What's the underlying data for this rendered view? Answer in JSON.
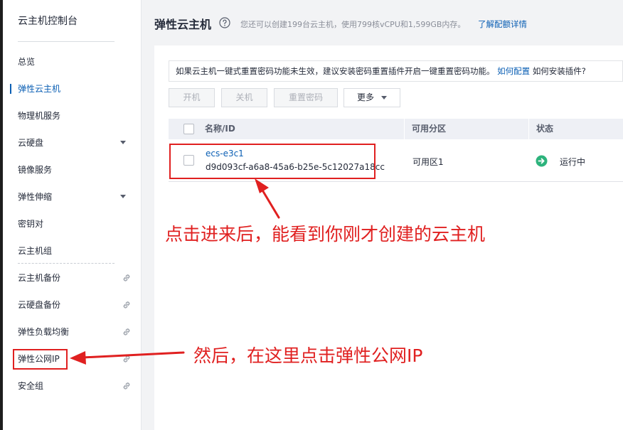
{
  "sidebar": {
    "title": "云主机控制台",
    "items": [
      {
        "label": "总览"
      },
      {
        "label": "弹性云主机"
      },
      {
        "label": "物理机服务"
      },
      {
        "label": "云硬盘"
      },
      {
        "label": "镜像服务"
      },
      {
        "label": "弹性伸缩"
      },
      {
        "label": "密钥对"
      },
      {
        "label": "云主机组"
      },
      {
        "label": "云主机备份"
      },
      {
        "label": "云硬盘备份"
      },
      {
        "label": "弹性负载均衡"
      },
      {
        "label": "弹性公网IP"
      },
      {
        "label": "安全组"
      }
    ]
  },
  "header": {
    "title": "弹性云主机",
    "description": "您还可以创建199台云主机，使用799核vCPU和1,599GB内存。",
    "link": "了解配额详情"
  },
  "notice": {
    "text": "如果云主机一键式重置密码功能未生效，建议安装密码重置插件开启一键重置密码功能。",
    "link": "如何配置",
    "tail": "如何安装插件?"
  },
  "toolbar": {
    "start": "开机",
    "stop": "关机",
    "reset_password": "重置密码",
    "more": "更多"
  },
  "table": {
    "columns": [
      "名称/ID",
      "可用分区",
      "状态"
    ],
    "rows": [
      {
        "name": "ecs-e3c1",
        "id": "d9d093cf-a6a8-45a6-b25e-5c12027a18cc",
        "zone": "可用区1",
        "status": "运行中"
      }
    ]
  },
  "annotations": {
    "first": "点击进来后，能看到你刚才创建的云主机",
    "second": "然后，在这里点击弹性公网IP"
  },
  "colors": {
    "accent": "#0b5fb4",
    "annotation": "#e02020",
    "status_ok": "#2db37c"
  }
}
